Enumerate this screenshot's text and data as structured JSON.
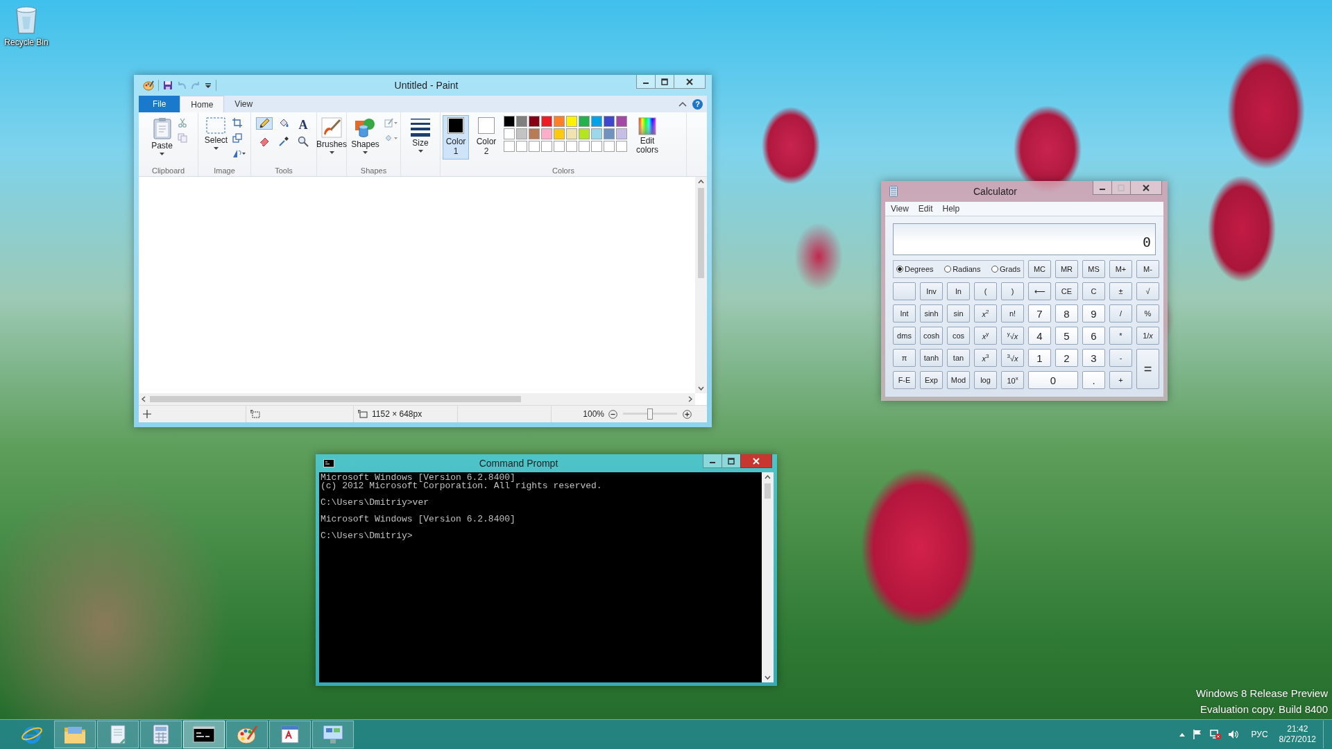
{
  "desktop": {
    "icons": [
      {
        "label": "Recycle Bin",
        "kind": "recycle-bin"
      }
    ],
    "watermark": [
      "Windows 8 Release Preview",
      "Evaluation copy. Build 8400"
    ]
  },
  "paint": {
    "title": "Untitled - Paint",
    "quick_access": [
      {
        "kind": "save",
        "disabled": false
      },
      {
        "kind": "undo",
        "disabled": true
      },
      {
        "kind": "redo",
        "disabled": true
      },
      {
        "kind": "customize",
        "disabled": false
      }
    ],
    "tabs": [
      {
        "label": "File",
        "kind": "menu",
        "selected": false
      },
      {
        "label": "Home",
        "kind": "tab",
        "selected": true
      },
      {
        "label": "View",
        "kind": "tab",
        "selected": false
      }
    ],
    "help": "?",
    "ribbon": {
      "paste": "Paste",
      "select": "Select",
      "brushes": "Brushes",
      "shapes": "Shapes",
      "size": "Size",
      "edit_colors": "Edit colors",
      "group_labels": [
        "Clipboard",
        "Image",
        "Tools",
        "Shapes",
        "Colors"
      ],
      "tools": [
        {
          "kind": "pencil",
          "selected": true
        },
        {
          "kind": "fill",
          "selected": false
        },
        {
          "kind": "text",
          "selected": false,
          "glyph": "A"
        },
        {
          "kind": "eraser",
          "selected": false
        },
        {
          "kind": "picker",
          "selected": false
        },
        {
          "kind": "magnifier",
          "selected": false
        }
      ],
      "color_slots": [
        {
          "label": "Color 1",
          "color": "#000000",
          "selected": true
        },
        {
          "label": "Color 2",
          "color": "#ffffff",
          "selected": false
        }
      ],
      "palette": [
        {
          "color": "#000000"
        },
        {
          "color": "#7f7f7f"
        },
        {
          "color": "#880015"
        },
        {
          "color": "#ed1c24"
        },
        {
          "color": "#ff7f27"
        },
        {
          "color": "#fff200"
        },
        {
          "color": "#22b14c"
        },
        {
          "color": "#00a2e8"
        },
        {
          "color": "#3f48cc"
        },
        {
          "color": "#a349a4"
        },
        {
          "color": "#ffffff"
        },
        {
          "color": "#c3c3c3"
        },
        {
          "color": "#b97a57"
        },
        {
          "color": "#ffaec9"
        },
        {
          "color": "#ffc90e"
        },
        {
          "color": "#efe4b0"
        },
        {
          "color": "#b5e61d"
        },
        {
          "color": "#99d9ea"
        },
        {
          "color": "#7092be"
        },
        {
          "color": "#c8bfe7"
        },
        {
          "color": "#ffffff"
        },
        {
          "color": "#ffffff"
        },
        {
          "color": "#ffffff"
        },
        {
          "color": "#ffffff"
        },
        {
          "color": "#ffffff"
        },
        {
          "color": "#ffffff"
        },
        {
          "color": "#ffffff"
        },
        {
          "color": "#ffffff"
        },
        {
          "color": "#ffffff"
        },
        {
          "color": "#ffffff"
        }
      ]
    },
    "status": {
      "dimensions": "1152 × 648px",
      "zoom": "100%",
      "zoom_slider": {
        "level": 0.5
      }
    }
  },
  "calculator": {
    "title": "Calculator",
    "menu": [
      "View",
      "Edit",
      "Help"
    ],
    "display": "0",
    "angle_units": [
      {
        "label": "Degrees",
        "selected": true
      },
      {
        "label": "Radians",
        "selected": false
      },
      {
        "label": "Grads",
        "selected": false
      }
    ],
    "memory": [
      "MC",
      "MR",
      "MS",
      "M+",
      "M-"
    ],
    "keys": [
      {
        "kind": "blank"
      },
      {
        "kind": "fn",
        "label": "Inv"
      },
      {
        "kind": "fn",
        "label": "ln"
      },
      {
        "kind": "fn",
        "label": "("
      },
      {
        "kind": "fn",
        "label": ")"
      },
      {
        "kind": "fn",
        "label": "⟵"
      },
      {
        "kind": "fn",
        "label": "CE"
      },
      {
        "kind": "fn",
        "label": "C"
      },
      {
        "kind": "fn",
        "label": "±"
      },
      {
        "kind": "fn",
        "label": "√"
      },
      {
        "kind": "fn",
        "label": "Int"
      },
      {
        "kind": "fn",
        "label": "sinh"
      },
      {
        "kind": "fn",
        "label": "sin"
      },
      {
        "kind": "fn",
        "label": "*x*$^{2}$"
      },
      {
        "kind": "fn",
        "label": "n!"
      },
      {
        "kind": "digit",
        "label": "7"
      },
      {
        "kind": "digit",
        "label": "8"
      },
      {
        "kind": "digit",
        "label": "9"
      },
      {
        "kind": "fn",
        "label": "/"
      },
      {
        "kind": "fn",
        "label": "%"
      },
      {
        "kind": "fn",
        "label": "dms"
      },
      {
        "kind": "fn",
        "label": "cosh"
      },
      {
        "kind": "fn",
        "label": "cos"
      },
      {
        "kind": "fn",
        "label": "*x*$^{y}$"
      },
      {
        "kind": "fn",
        "label": "$^{y}$√*x*"
      },
      {
        "kind": "digit",
        "label": "4"
      },
      {
        "kind": "digit",
        "label": "5"
      },
      {
        "kind": "digit",
        "label": "6"
      },
      {
        "kind": "fn",
        "label": "*"
      },
      {
        "kind": "fn",
        "label": "1/*x*"
      },
      {
        "kind": "fn",
        "label": "π"
      },
      {
        "kind": "fn",
        "label": "tanh"
      },
      {
        "kind": "fn",
        "label": "tan"
      },
      {
        "kind": "fn",
        "label": "*x*$^{3}$"
      },
      {
        "kind": "fn",
        "label": "$^{3}$√*x*"
      },
      {
        "kind": "digit",
        "label": "1"
      },
      {
        "kind": "digit",
        "label": "2"
      },
      {
        "kind": "digit",
        "label": "3"
      },
      {
        "kind": "fn",
        "label": "-"
      },
      {
        "kind": "equals",
        "label": "="
      },
      {
        "kind": "fn",
        "label": "F-E"
      },
      {
        "kind": "fn",
        "label": "Exp"
      },
      {
        "kind": "fn",
        "label": "Mod"
      },
      {
        "kind": "fn",
        "label": "log"
      },
      {
        "kind": "fn",
        "label": "10$^{x}$"
      },
      {
        "kind": "zero",
        "label": "0"
      },
      {
        "kind": "digit",
        "label": "."
      },
      {
        "kind": "fn",
        "label": "+"
      }
    ]
  },
  "cmd": {
    "title": "Command Prompt",
    "blocks": [
      [
        "Microsoft Windows [Version 6.2.8400]",
        "(c) 2012 Microsoft Corporation. All rights reserved."
      ],
      [
        "C:\\Users\\Dmitriy>ver"
      ],
      [
        "Microsoft Windows [Version 6.2.8400]"
      ],
      [
        "C:\\Users\\Dmitriy>"
      ]
    ]
  },
  "taskbar": {
    "apps": [
      {
        "kind": "browser",
        "running": false,
        "selected": false
      },
      {
        "kind": "folder",
        "running": true,
        "selected": false
      },
      {
        "kind": "notebook",
        "running": true,
        "selected": false
      },
      {
        "kind": "calculator",
        "running": true,
        "selected": false
      },
      {
        "kind": "terminal",
        "running": true,
        "selected": true
      },
      {
        "kind": "palette",
        "running": true,
        "selected": false
      },
      {
        "kind": "document",
        "running": true,
        "selected": false
      },
      {
        "kind": "window",
        "running": true,
        "selected": false
      }
    ],
    "tray": {
      "language": "РУС",
      "time": "21:42",
      "date": "8/27/2012"
    }
  }
}
